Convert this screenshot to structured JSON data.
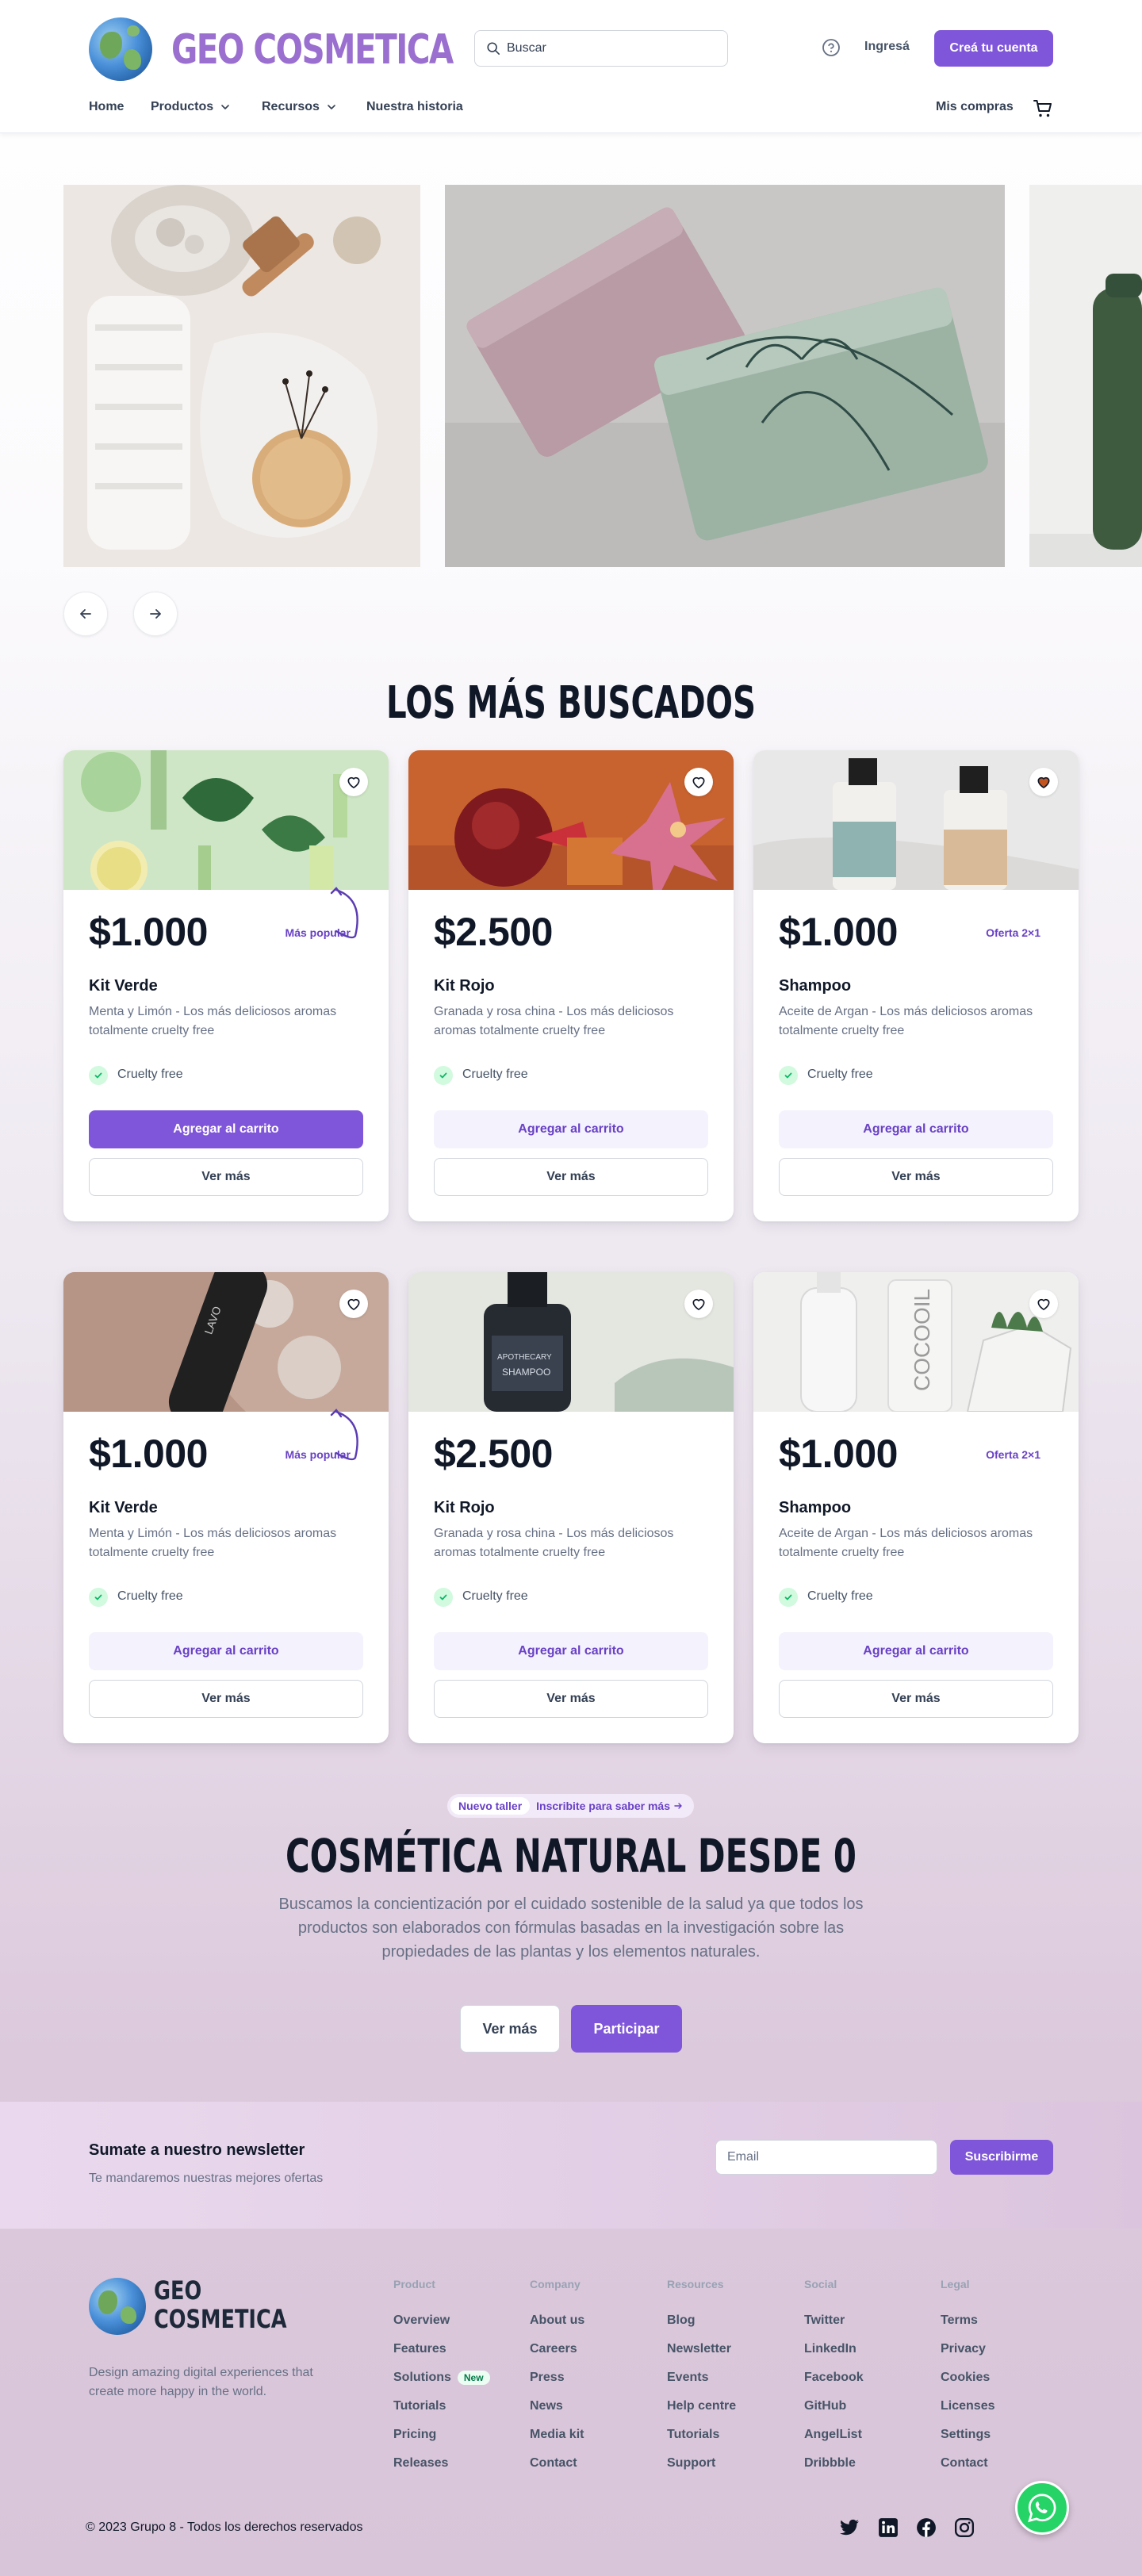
{
  "header": {
    "brand": "GEO COSMETICA",
    "search_placeholder": "Buscar",
    "login": "Ingresá",
    "signup": "Creá tu cuenta",
    "nav": [
      {
        "label": "Home"
      },
      {
        "label": "Productos"
      },
      {
        "label": "Recursos"
      },
      {
        "label": "Nuestra historia"
      }
    ],
    "my_purchases": "Mis compras"
  },
  "bestsellers": {
    "title": "LOS MÁS BUSCADOS",
    "products": [
      {
        "price": "$1.000",
        "badge": "Más popular",
        "name": "Kit Verde",
        "desc": "Menta y Limón - Los más deliciosos aromas totalmente cruelty free",
        "feature": "Cruelty free",
        "add": "Agregar al carrito",
        "more": "Ver más"
      },
      {
        "price": "$2.500",
        "badge": "",
        "name": "Kit Rojo",
        "desc": "Granada y rosa china - Los más deliciosos aromas totalmente cruelty free",
        "feature": "Cruelty free",
        "add": "Agregar al carrito",
        "more": "Ver más"
      },
      {
        "price": "$1.000",
        "badge": "Oferta 2×1",
        "name": "Shampoo",
        "desc": "Aceite de Argan - Los más deliciosos aromas totalmente cruelty free",
        "feature": "Cruelty free",
        "add": "Agregar al carrito",
        "more": "Ver más"
      },
      {
        "price": "$1.000",
        "badge": "Más popular",
        "name": "Kit Verde",
        "desc": "Menta y Limón - Los más deliciosos aromas totalmente cruelty free",
        "feature": "Cruelty free",
        "add": "Agregar al carrito",
        "more": "Ver más"
      },
      {
        "price": "$2.500",
        "badge": "",
        "name": "Kit Rojo",
        "desc": "Granada y rosa china - Los más deliciosos aromas totalmente cruelty free",
        "feature": "Cruelty free",
        "add": "Agregar al carrito",
        "more": "Ver más"
      },
      {
        "price": "$1.000",
        "badge": "Oferta 2×1",
        "name": "Shampoo",
        "desc": "Aceite de Argan - Los más deliciosos aromas totalmente cruelty free",
        "feature": "Cruelty free",
        "add": "Agregar al carrito",
        "more": "Ver más"
      }
    ]
  },
  "workshop": {
    "pill_tag": "Nuevo taller",
    "pill_link": "Inscribite para saber más",
    "title": "COSMÉTICA NATURAL DESDE 0",
    "desc": "Buscamos la concientización por el cuidado sostenible de la salud ya que todos los productos son elaborados con fórmulas basadas en la investigación sobre las propiedades de las plantas y los elementos naturales.",
    "btn_more": "Ver más",
    "btn_join": "Participar"
  },
  "newsletter": {
    "title": "Sumate a nuestro newsletter",
    "subtitle": "Te mandaremos nuestras mejores ofertas",
    "placeholder": "Email",
    "button": "Suscribirme"
  },
  "footer": {
    "brand_line1": "GEO",
    "brand_line2": "COSMETICA",
    "desc": "Design amazing digital experiences that create more happy in the world.",
    "columns": [
      {
        "title": "Product",
        "links": [
          "Overview",
          "Features",
          "Solutions",
          "Tutorials",
          "Pricing",
          "Releases"
        ],
        "new_badge": "New"
      },
      {
        "title": "Company",
        "links": [
          "About us",
          "Careers",
          "Press",
          "News",
          "Media kit",
          "Contact"
        ]
      },
      {
        "title": "Resources",
        "links": [
          "Blog",
          "Newsletter",
          "Events",
          "Help centre",
          "Tutorials",
          "Support"
        ]
      },
      {
        "title": "Social",
        "links": [
          "Twitter",
          "LinkedIn",
          "Facebook",
          "GitHub",
          "AngelList",
          "Dribbble"
        ]
      },
      {
        "title": "Legal",
        "links": [
          "Terms",
          "Privacy",
          "Cookies",
          "Licenses",
          "Settings",
          "Contact"
        ]
      }
    ],
    "copyright": "© 2023 Grupo 8 - Todos los derechos reservados"
  },
  "colors": {
    "primary": "#7f56d9",
    "primary_text": "#6941c6",
    "brand": "#9a6fcf",
    "whatsapp": "#25d366"
  },
  "icons": [
    "search-icon",
    "help-icon",
    "cart-icon",
    "chevron-down-icon",
    "arrow-left-icon",
    "arrow-right-icon",
    "heart-icon",
    "check-icon",
    "twitter-icon",
    "linkedin-icon",
    "facebook-icon",
    "instagram-icon",
    "whatsapp-icon"
  ]
}
